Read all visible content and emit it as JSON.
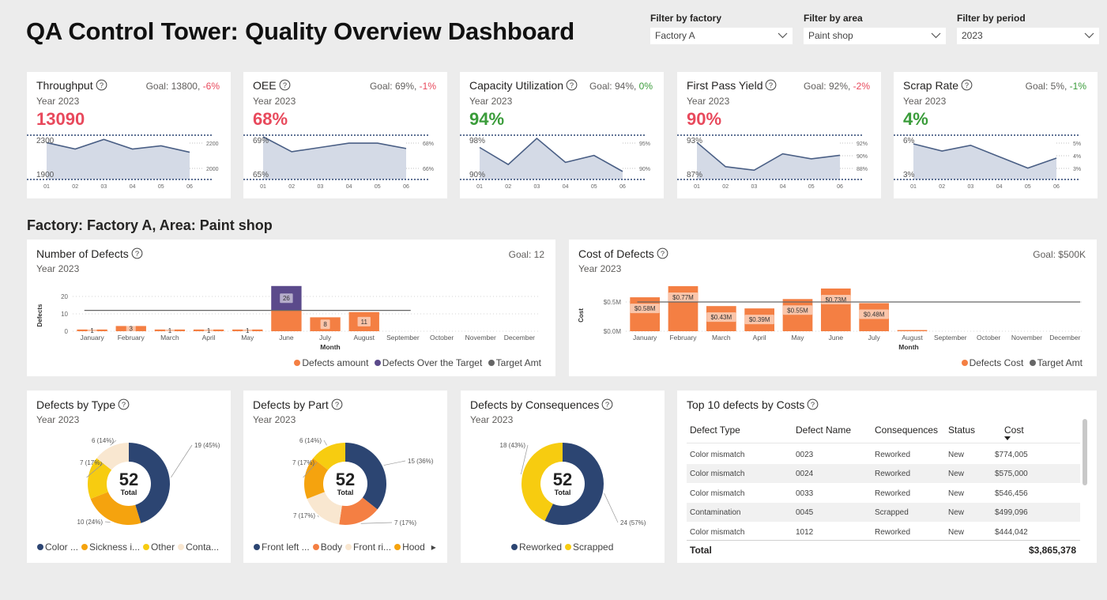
{
  "header": {
    "title": "QA Control Tower: Quality Overview Dashboard"
  },
  "filters": [
    {
      "label": "Filter by factory",
      "value": "Factory A"
    },
    {
      "label": "Filter by area",
      "value": "Paint shop"
    },
    {
      "label": "Filter by period",
      "value": "2023"
    }
  ],
  "kpis": [
    {
      "name": "Throughput",
      "goal_text": "Goal: 13800, ",
      "delta": "-6%",
      "delta_status": "neg",
      "year": "Year 2023",
      "value": "13090",
      "value_status": "neg",
      "top_label": "2300",
      "bottom_label": "1900",
      "right_labels": [
        "2200",
        "2000"
      ],
      "x": [
        "01",
        "02",
        "03",
        "04",
        "05",
        "06"
      ],
      "series": [
        2245,
        2185,
        2275,
        2185,
        2215,
        2155
      ],
      "ymin": 1900,
      "ymax": 2300
    },
    {
      "name": "OEE",
      "goal_text": "Goal: 69%, ",
      "delta": "-1%",
      "delta_status": "neg",
      "year": "Year 2023",
      "value": "68%",
      "value_status": "neg",
      "top_label": "69%",
      "bottom_label": "65%",
      "right_labels": [
        "68%",
        "66%"
      ],
      "x": [
        "01",
        "02",
        "03",
        "04",
        "05",
        "06"
      ],
      "series": [
        69.0,
        67.6,
        68.0,
        68.4,
        68.4,
        67.9
      ],
      "ymin": 65,
      "ymax": 69
    },
    {
      "name": "Capacity Utilization",
      "goal_text": "Goal: 94%, ",
      "delta": "0%",
      "delta_status": "pos",
      "year": "Year 2023",
      "value": "94%",
      "value_status": "pos",
      "top_label": "98%",
      "bottom_label": "90%",
      "right_labels": [
        "95%",
        "90%"
      ],
      "x": [
        "01",
        "02",
        "03",
        "04",
        "05",
        "06"
      ],
      "series": [
        96.0,
        92.8,
        97.7,
        93.2,
        94.5,
        91.5
      ],
      "ymin": 90,
      "ymax": 98
    },
    {
      "name": "First Pass Yield",
      "goal_text": "Goal: 92%, ",
      "delta": "-2%",
      "delta_status": "neg",
      "year": "Year 2023",
      "value": "90%",
      "value_status": "neg",
      "top_label": "93%",
      "bottom_label": "87%",
      "right_labels": [
        "92%",
        "90%",
        "88%"
      ],
      "x": [
        "01",
        "02",
        "03",
        "04",
        "05",
        "06"
      ],
      "series": [
        92.2,
        88.8,
        88.3,
        90.6,
        89.9,
        90.4
      ],
      "ymin": 87,
      "ymax": 93
    },
    {
      "name": "Scrap Rate",
      "goal_text": "Goal: 5%, ",
      "delta": "-1%",
      "delta_status": "pos",
      "year": "Year 2023",
      "value": "4%",
      "value_status": "pos",
      "top_label": "6%",
      "bottom_label": "3%",
      "right_labels": [
        "5%",
        "4%",
        "3%"
      ],
      "x": [
        "01",
        "02",
        "03",
        "04",
        "05",
        "06"
      ],
      "series": [
        5.5,
        5.0,
        5.4,
        4.6,
        3.8,
        4.5
      ],
      "ymin": 3,
      "ymax": 6
    }
  ],
  "section_title": "Factory: Factory A, Area: Paint shop",
  "defects_chart": {
    "title": "Number of Defects",
    "subtitle": "Year 2023",
    "goal": "Goal: 12",
    "ylabel": "Defects",
    "xlabel": "Month",
    "yticks": [
      "0",
      "10",
      "20"
    ],
    "legend": [
      "Defects amount",
      "Defects Over the Target",
      "Target Amt"
    ]
  },
  "cost_chart": {
    "title": "Cost of Defects",
    "subtitle": "Year 2023",
    "goal": "Goal: $500K",
    "ylabel": "Cost",
    "xlabel": "Month",
    "yticks": [
      "$0.0M",
      "$0.5M"
    ],
    "legend": [
      "Defects Cost",
      "Target Amt"
    ]
  },
  "chart_data": [
    {
      "type": "bar",
      "title": "Number of Defects",
      "xlabel": "Month",
      "ylabel": "Defects",
      "categories": [
        "January",
        "February",
        "March",
        "April",
        "May",
        "June",
        "July",
        "August",
        "September",
        "October",
        "November",
        "December"
      ],
      "series": [
        {
          "name": "Defects amount",
          "values": [
            1,
            3,
            1,
            1,
            1,
            12,
            8,
            11,
            0,
            0,
            0,
            0
          ],
          "labels": [
            "1",
            "3",
            "1",
            "1",
            "1",
            "",
            "8",
            "11",
            "",
            "",
            "",
            ""
          ]
        },
        {
          "name": "Defects Over the Target",
          "values": [
            0,
            0,
            0,
            0,
            0,
            14,
            0,
            0,
            0,
            0,
            0,
            0
          ],
          "labels": [
            "",
            "",
            "",
            "",
            "",
            "26",
            "",
            "",
            "",
            "",
            "",
            ""
          ]
        }
      ],
      "target": 12,
      "ylim": [
        0,
        26
      ]
    },
    {
      "type": "bar",
      "title": "Cost of Defects",
      "xlabel": "Month",
      "ylabel": "Cost",
      "categories": [
        "January",
        "February",
        "March",
        "April",
        "May",
        "June",
        "July",
        "August",
        "September",
        "October",
        "November",
        "December"
      ],
      "series": [
        {
          "name": "Defects Cost",
          "values": [
            0.58,
            0.77,
            0.43,
            0.39,
            0.55,
            0.73,
            0.48,
            0.02,
            0,
            0,
            0,
            0
          ],
          "labels": [
            "$0.58M",
            "$0.77M",
            "$0.43M",
            "$0.39M",
            "$0.55M",
            "$0.73M",
            "$0.48M",
            "",
            "",
            "",
            "",
            ""
          ]
        }
      ],
      "target": 0.5,
      "ylim": [
        0,
        0.8
      ]
    },
    {
      "type": "pie",
      "title": "Defects by Type",
      "total": 52,
      "slices": [
        {
          "name": "Color ...",
          "value": 19,
          "label": "19 (45%)",
          "color": "#2c4572"
        },
        {
          "name": "Sickness i...",
          "value": 10,
          "label": "10 (24%)",
          "color": "#f5a30e"
        },
        {
          "name": "Other",
          "value": 7,
          "label": "7 (17%)",
          "color": "#f7cc10"
        },
        {
          "name": "Conta...",
          "value": 6,
          "label": "6 (14%)",
          "color": "#f9e7d0"
        }
      ]
    },
    {
      "type": "pie",
      "title": "Defects by Part",
      "total": 52,
      "slices": [
        {
          "name": "Front left ...",
          "value": 15,
          "label": "15 (36%)",
          "color": "#2c4572"
        },
        {
          "name": "Body",
          "value": 7,
          "label": "7 (17%)",
          "color": "#f47f43"
        },
        {
          "name": "Front ri...",
          "value": 7,
          "label": "7 (17%)",
          "color": "#f9e7d0"
        },
        {
          "name": "Hood",
          "value": 7,
          "label": "7 (17%)",
          "color": "#f5a30e"
        },
        {
          "name": "",
          "value": 6,
          "label": "6 (14%)",
          "color": "#f7cc10"
        }
      ]
    },
    {
      "type": "pie",
      "title": "Defects by Consequences",
      "total": 52,
      "slices": [
        {
          "name": "Reworked",
          "value": 24,
          "label": "24 (57%)",
          "color": "#2c4572"
        },
        {
          "name": "Scrapped",
          "value": 18,
          "label": "18 (43%)",
          "color": "#f7cc10"
        }
      ]
    }
  ],
  "donuts": [
    {
      "title": "Defects by Type",
      "subtitle": "Year 2023",
      "total": "52",
      "total_label": "Total",
      "legend_arrow": ""
    },
    {
      "title": "Defects by Part",
      "subtitle": "Year 2023",
      "total": "52",
      "total_label": "Total",
      "legend_arrow": "▸"
    },
    {
      "title": "Defects by Consequences",
      "subtitle": "Year 2023",
      "total": "52",
      "total_label": "Total",
      "legend_arrow": ""
    }
  ],
  "table": {
    "title": "Top 10 defects by Costs",
    "columns": [
      "Defect Type",
      "Defect Name",
      "Consequences",
      "Status",
      "Cost"
    ],
    "rows": [
      [
        "Color mismatch",
        "0023",
        "Reworked",
        "New",
        "$774,005"
      ],
      [
        "Color mismatch",
        "0024",
        "Reworked",
        "New",
        "$575,000"
      ],
      [
        "Color mismatch",
        "0033",
        "Reworked",
        "New",
        "$546,456"
      ],
      [
        "Contamination",
        "0045",
        "Scrapped",
        "New",
        "$499,096"
      ],
      [
        "Color mismatch",
        "1012",
        "Reworked",
        "New",
        "$444,042"
      ]
    ],
    "total_label": "Total",
    "total_value": "$3,865,378"
  },
  "colors": {
    "negative": "#e8495c",
    "positive": "#3a9c3a",
    "bar_orange": "#f47f43",
    "bar_purple": "#5b4a8b",
    "spark_line": "#4a5f85",
    "spark_fill": "#d4dae6"
  }
}
